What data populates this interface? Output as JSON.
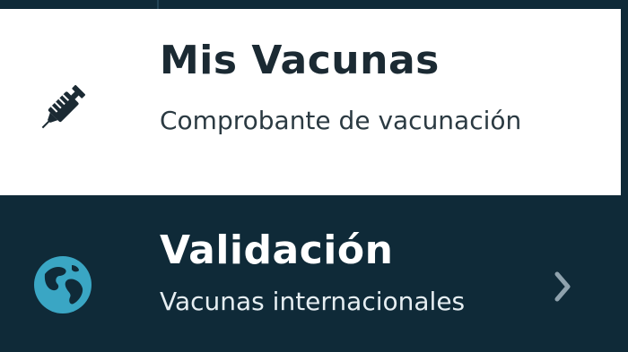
{
  "menu": {
    "items": [
      {
        "title": "Mis Vacunas",
        "subtitle": "Comprobante de vacunación",
        "icon": "syringe-icon"
      },
      {
        "title": "Validación",
        "subtitle": "Vacunas internacionales",
        "icon": "globe-icon",
        "trailing_icon": "chevron-right-icon"
      }
    ]
  },
  "colors": {
    "dark_background": "#0f2a38",
    "light_background": "#ffffff",
    "globe_accent": "#3aa6c4",
    "dark_text": "#1b2a33"
  }
}
